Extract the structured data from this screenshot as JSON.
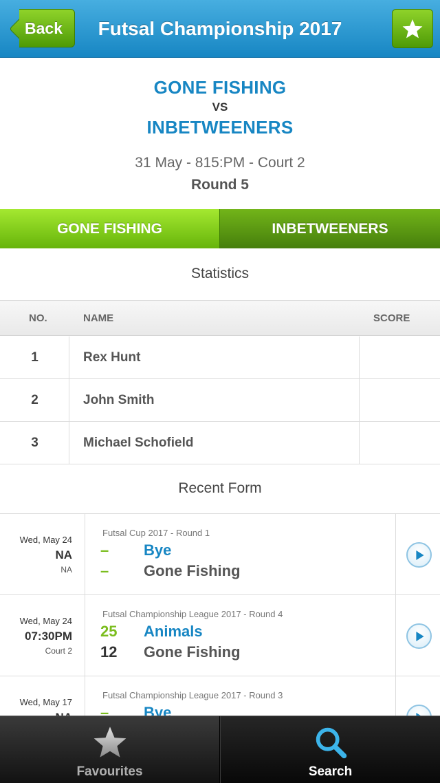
{
  "header": {
    "back_label": "Back",
    "title": "Futsal Championship 2017",
    "favourite_icon": "star-icon"
  },
  "match": {
    "home_team": "GONE FISHING",
    "vs": "VS",
    "away_team": "INBETWEENERS",
    "when": "31 May - 815:PM - Court 2",
    "round": "Round 5"
  },
  "team_tabs": [
    {
      "label": "GONE FISHING",
      "selected": true
    },
    {
      "label": "INBETWEENERS",
      "selected": false
    }
  ],
  "statistics": {
    "title": "Statistics",
    "columns": {
      "no": "NO.",
      "name": "NAME",
      "score": "SCORE"
    },
    "rows": [
      {
        "no": "1",
        "name": "Rex Hunt",
        "score": ""
      },
      {
        "no": "2",
        "name": "John Smith",
        "score": ""
      },
      {
        "no": "3",
        "name": "Michael Schofield",
        "score": ""
      }
    ]
  },
  "recent_form": {
    "title": "Recent Form",
    "items": [
      {
        "date": "Wed, May 24",
        "time": "NA",
        "court": "NA",
        "competition": "Futsal Cup 2017 - Round 1",
        "score1": "–",
        "team1": "Bye",
        "score2": "–",
        "team2": "Gone Fishing"
      },
      {
        "date": "Wed, May 24",
        "time": "07:30PM",
        "court": "Court 2",
        "competition": "Futsal Championship League 2017 - Round 4",
        "score1": "25",
        "team1": "Animals",
        "score2": "12",
        "team2": "Gone Fishing"
      },
      {
        "date": "Wed, May 17",
        "time": "NA",
        "court": "",
        "competition": "Futsal Championship League 2017 - Round 3",
        "score1": "–",
        "team1": "Bye",
        "score2": "",
        "team2": ""
      }
    ]
  },
  "tabbar": {
    "favourites_label": "Favourites",
    "search_label": "Search",
    "active": "search"
  },
  "colors": {
    "header_blue": "#1786c3",
    "accent_green": "#7bbd1e",
    "team_blue": "#1786c3"
  }
}
